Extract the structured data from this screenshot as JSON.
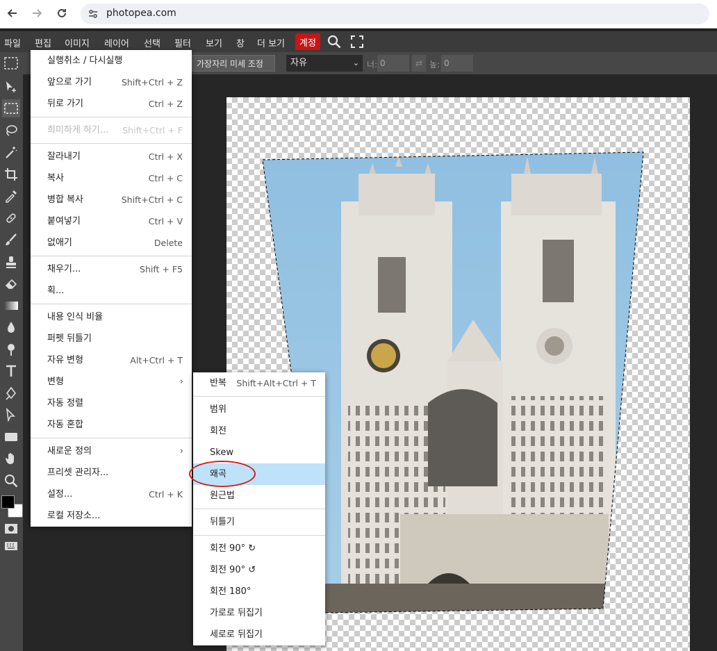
{
  "browser": {
    "back_icon": "arrow-left-icon",
    "forward_icon": "arrow-right-icon",
    "reload_icon": "reload-icon",
    "url": "photopea.com"
  },
  "menubar": {
    "items": [
      "파일",
      "편집",
      "이미지",
      "레이어",
      "선택",
      "필터",
      "보기",
      "창",
      "더 보기"
    ],
    "account_label": "계정",
    "account_color": "#c91515"
  },
  "options_bar": {
    "refine_edge_label": "가장자리 미세 조정",
    "style_value": "자유",
    "width_label": "너:",
    "width_value": "0",
    "height_label": "높:",
    "height_value": "0"
  },
  "edit_menu": {
    "undo_redo": "실행취소 / 다시실행",
    "step_forward": "앞으로 가기",
    "step_forward_shortcut": "Shift+Ctrl + Z",
    "step_backward": "뒤로 가기",
    "step_backward_shortcut": "Ctrl + Z",
    "fade": "희미하게 하기...",
    "fade_shortcut": "Shift+Ctrl + F",
    "cut": "잘라내기",
    "cut_shortcut": "Ctrl + X",
    "copy": "복사",
    "copy_shortcut": "Ctrl + C",
    "copy_merged": "병합 복사",
    "copy_merged_shortcut": "Shift+Ctrl + C",
    "paste": "붙여넣기",
    "paste_shortcut": "Ctrl + V",
    "clear": "없애기",
    "clear_shortcut": "Delete",
    "fill": "채우기...",
    "fill_shortcut": "Shift + F5",
    "stroke": "획...",
    "content_aware_scale": "내용 인식 비율",
    "puppet_warp": "퍼펫 뒤틀기",
    "free_transform": "자유 변형",
    "free_transform_shortcut": "Alt+Ctrl + T",
    "transform": "변형",
    "auto_align": "자동 정렬",
    "auto_blend": "자동 혼합",
    "define_new": "새로운 정의",
    "preset_manager": "프리셋 관리자...",
    "preferences": "설정...",
    "preferences_shortcut": "Ctrl + K",
    "local_storage": "로컬 저장소..."
  },
  "transform_menu": {
    "again": "반복",
    "again_shortcut": "Shift+Alt+Ctrl + T",
    "scale": "범위",
    "rotate": "회전",
    "skew": "Skew",
    "distort": "왜곡",
    "perspective": "원근법",
    "warp": "뒤틀기",
    "rotate_cw": "회전 90° ↻",
    "rotate_ccw": "회전 90° ↺",
    "rotate_180": "회전 180°",
    "flip_h": "가로로 뒤집기",
    "flip_v": "세로로 뒤집기",
    "highlight_color": "#bde2f9"
  }
}
